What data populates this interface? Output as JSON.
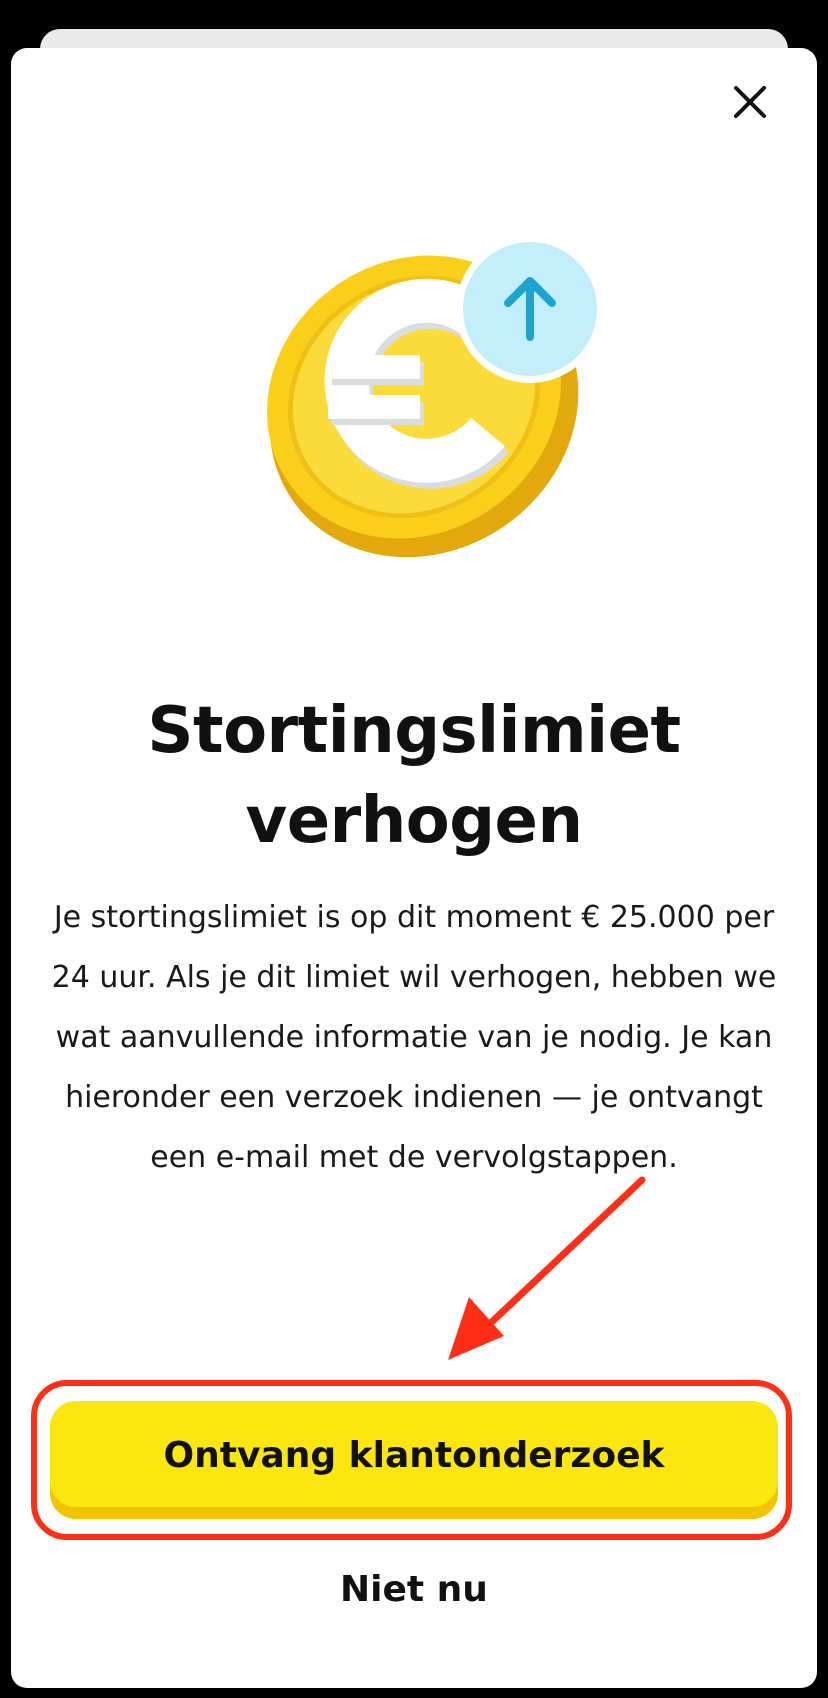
{
  "dialog": {
    "title_line1": "Stortingslimiet",
    "title_line2": "verhogen",
    "body": "Je stortingslimiet is op dit moment € 25.000 per 24 uur. Als je dit limiet wil verhogen, hebben we wat aanvullende informatie van je nodig. Je kan hieronder een verzoek indienen — je ontvangt een e-mail met de vervolgstappen.",
    "primary_button": "Ontvang klantonderzoek",
    "secondary_button": "Niet nu"
  },
  "icons": {
    "close": "close-icon",
    "hero": "euro-coin-icon",
    "hero_badge": "arrow-up-icon",
    "annotation": "annotation-arrow"
  },
  "colors": {
    "background": "#000000",
    "sheet": "#ffffff",
    "primary_button": "#fbe70f",
    "primary_button_shadow": "#f2c400",
    "coin": "#f9cf1a",
    "badge": "#c3eefb",
    "badge_arrow": "#1ea3cf",
    "annotation": "#ff2f17",
    "text": "#111111"
  }
}
